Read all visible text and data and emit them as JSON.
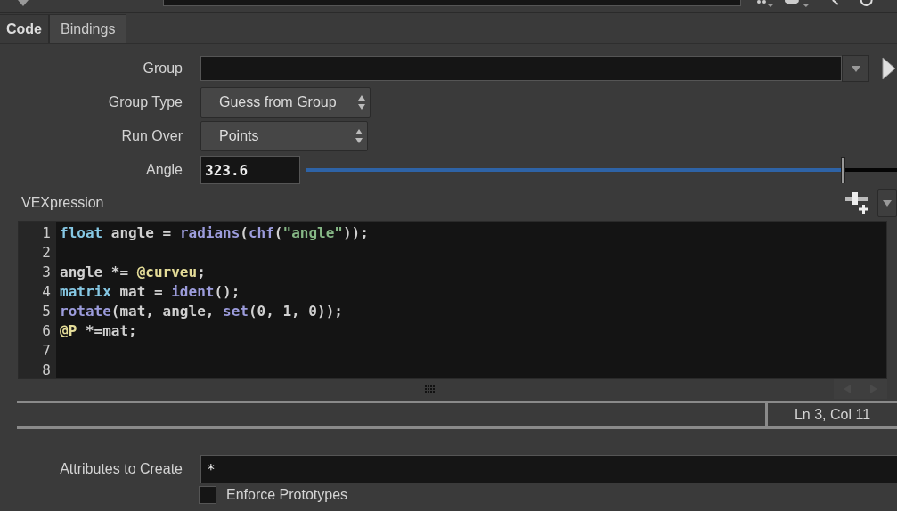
{
  "tabs": [
    {
      "label": "Code",
      "selected": true
    },
    {
      "label": "Bindings",
      "selected": false
    }
  ],
  "group": {
    "label": "Group"
  },
  "group_type": {
    "label": "Group Type",
    "value": "Guess from Group"
  },
  "run_over": {
    "label": "Run Over",
    "value": "Points"
  },
  "angle": {
    "label": "Angle",
    "value": "323.6",
    "level": 0.91
  },
  "vexpression": {
    "label": "VEXpression",
    "lines": [
      {
        "number": "1",
        "tokens": [
          {
            "text": "float",
            "kind": "keyword"
          },
          {
            "text": " angle = ",
            "kind": "plain"
          },
          {
            "text": "radians",
            "kind": "function"
          },
          {
            "text": "(",
            "kind": "plain"
          },
          {
            "text": "chf",
            "kind": "function"
          },
          {
            "text": "(",
            "kind": "plain"
          },
          {
            "text": "\"angle\"",
            "kind": "string"
          },
          {
            "text": "));",
            "kind": "plain"
          }
        ]
      },
      {
        "number": "2"
      },
      {
        "number": "3",
        "tokens": [
          {
            "text": "angle *= ",
            "kind": "plain"
          },
          {
            "text": "@curveu",
            "kind": "attribute"
          },
          {
            "text": ";",
            "kind": "plain"
          }
        ]
      },
      {
        "number": "4",
        "tokens": [
          {
            "text": "matrix",
            "kind": "keyword"
          },
          {
            "text": " mat = ",
            "kind": "plain"
          },
          {
            "text": "ident",
            "kind": "function"
          },
          {
            "text": "();",
            "kind": "plain"
          }
        ]
      },
      {
        "number": "5",
        "tokens": [
          {
            "text": "rotate",
            "kind": "function"
          },
          {
            "text": "(mat, angle, ",
            "kind": "plain"
          },
          {
            "text": "set",
            "kind": "function"
          },
          {
            "text": "(0, 1, 0));",
            "kind": "plain"
          }
        ]
      },
      {
        "number": "6",
        "tokens": [
          {
            "text": "@P",
            "kind": "attribute"
          },
          {
            "text": " *=mat;",
            "kind": "plain"
          }
        ]
      },
      {
        "number": "7"
      },
      {
        "number": "8"
      }
    ],
    "status": "Ln 3, Col 11"
  },
  "attributes_to_create": {
    "label": "Attributes to Create",
    "value": "*"
  },
  "enforce_prototypes": {
    "label": "Enforce Prototypes",
    "checked": false
  }
}
